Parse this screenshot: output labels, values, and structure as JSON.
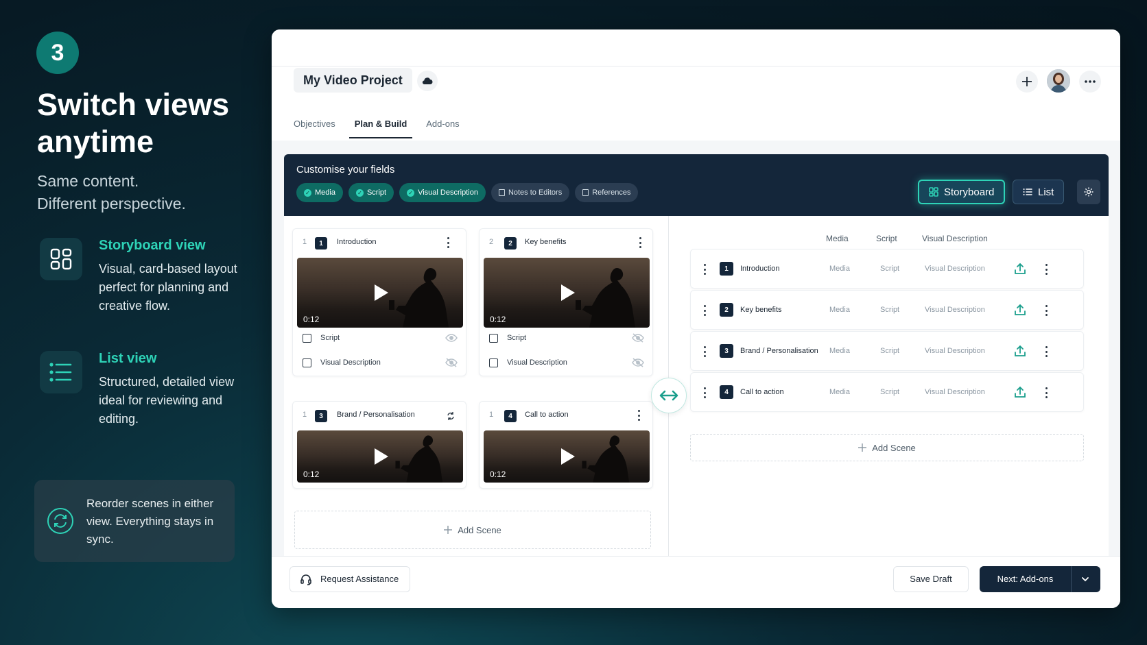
{
  "step": "3",
  "headline": "Switch views anytime",
  "subline_1": "Same content.",
  "subline_2": "Different perspective.",
  "features": [
    {
      "title": "Storyboard view",
      "desc": "Visual, card-based layout perfect for planning and creative flow.",
      "icon": "grid-icon"
    },
    {
      "title": "List view",
      "desc": "Structured, detailed view ideal for reviewing and editing.",
      "icon": "list-icon"
    }
  ],
  "sync_note": "Reorder scenes in either view. Everything stays in sync.",
  "app": {
    "project_title": "My Video Project",
    "tabs": [
      "Objectives",
      "Plan & Build",
      "Add-ons"
    ],
    "active_tab": "Plan & Build",
    "customise_title": "Customise your fields",
    "chips": [
      {
        "label": "Media",
        "on": true
      },
      {
        "label": "Script",
        "on": true
      },
      {
        "label": "Visual Description",
        "on": true
      },
      {
        "label": "Notes to Editors",
        "on": false
      },
      {
        "label": "References",
        "on": false
      }
    ],
    "view_storyboard": "Storyboard",
    "view_list": "List",
    "active_view": "Storyboard",
    "accent_color": "#2ed3b7",
    "dark_color": "#14263a",
    "cards": [
      {
        "index": "1",
        "num": "1",
        "title": "Introduction",
        "duration": "0:12",
        "fields": [
          "Script",
          "Visual Description"
        ]
      },
      {
        "index": "2",
        "num": "2",
        "title": "Key benefits",
        "duration": "0:12",
        "fields": [
          "Script",
          "Visual Description"
        ]
      },
      {
        "index": "1",
        "num": "3",
        "title": "Brand / Personalisation",
        "duration": "0:12"
      },
      {
        "index": "1",
        "num": "4",
        "title": "Call to action",
        "duration": "0:12"
      }
    ],
    "add_scene": "Add Scene",
    "list_headers": [
      "Media",
      "Script",
      "Visual Description"
    ],
    "list_rows": [
      {
        "num": "1",
        "title": "Introduction",
        "media": "Media",
        "script": "Script",
        "visual": "Visual Description"
      },
      {
        "num": "2",
        "title": "Key benefits",
        "media": "Media",
        "script": "Script",
        "visual": "Visual Description"
      },
      {
        "num": "3",
        "title": "Brand / Personalisation",
        "media": "Media",
        "script": "Script",
        "visual": "Visual Description"
      },
      {
        "num": "4",
        "title": "Call to action",
        "media": "Media",
        "script": "Script",
        "visual": "Visual Description"
      }
    ],
    "footer": {
      "request_assistance": "Request Assistance",
      "save_draft": "Save Draft",
      "next": "Next: Add-ons"
    }
  }
}
